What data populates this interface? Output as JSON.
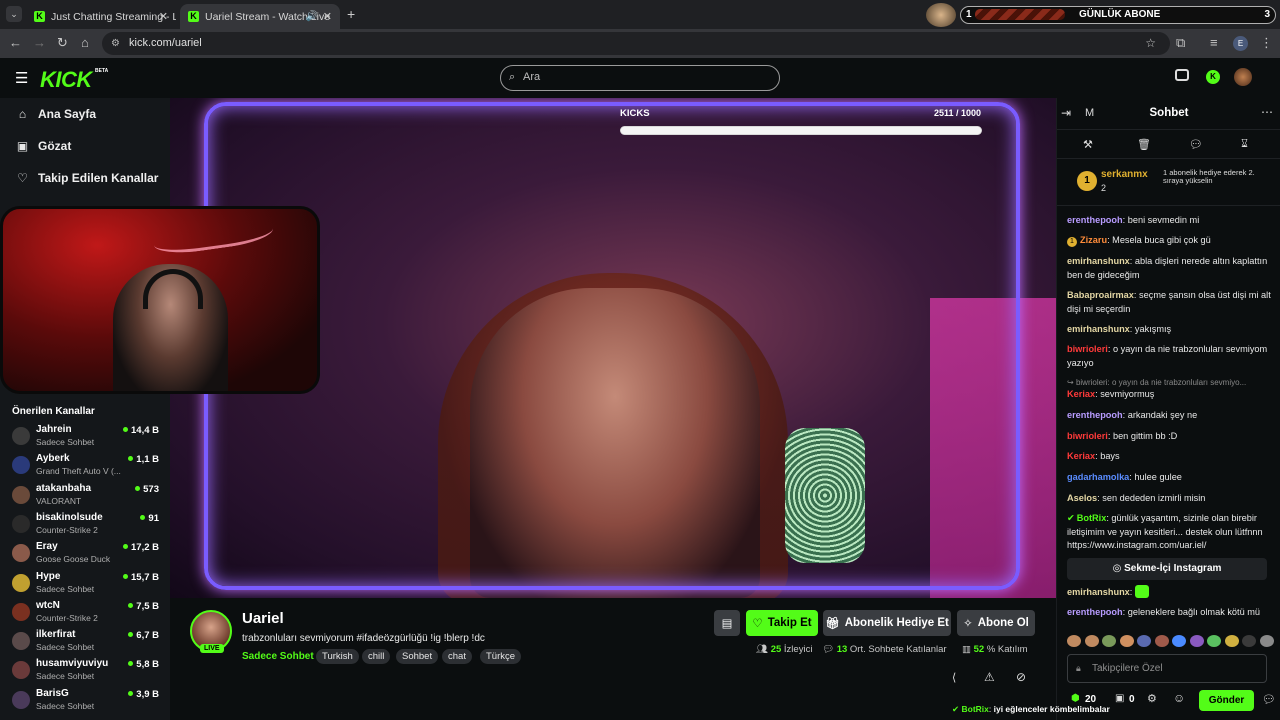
{
  "browser": {
    "tabs": [
      {
        "title": "Just Chatting Streaming - Live S"
      },
      {
        "title": "Uariel Stream - Watch Live"
      }
    ],
    "url": "kick.com/uariel",
    "ext_banner": {
      "left_num": "1",
      "label": "GÜNLÜK ABONE",
      "right_num": "3"
    },
    "profile_initial": "E"
  },
  "header": {
    "logo": "KICK",
    "beta": "BETA",
    "search_placeholder": "Ara"
  },
  "sidebar": {
    "nav": [
      {
        "label": "Ana Sayfa",
        "icon": "home-icon"
      },
      {
        "label": "Gözat",
        "icon": "browse-icon"
      },
      {
        "label": "Takip Edilen Kanallar",
        "icon": "heart-icon"
      }
    ],
    "recommended_title": "Önerilen Kanallar",
    "recommended": [
      {
        "name": "Jahrein",
        "category": "Sadece Sohbet",
        "viewers": "14,4 B",
        "color": "#3a3a3a"
      },
      {
        "name": "Ayberk",
        "category": "Grand Theft Auto V (...",
        "viewers": "1,1 B",
        "color": "#2a3a7a"
      },
      {
        "name": "atakanbaha",
        "category": "VALORANT",
        "viewers": "573",
        "color": "#6a4a3a"
      },
      {
        "name": "bisakinolsude",
        "category": "Counter-Strike 2",
        "viewers": "91",
        "color": "#2a2a2a"
      },
      {
        "name": "Eray",
        "category": "Goose Goose Duck",
        "viewers": "17,2 B",
        "color": "#8a5a4a"
      },
      {
        "name": "Hype",
        "category": "Sadece Sohbet",
        "viewers": "15,7 B",
        "color": "#c0a030"
      },
      {
        "name": "wtcN",
        "category": "Counter-Strike 2",
        "viewers": "7,5 B",
        "color": "#7a3020"
      },
      {
        "name": "ilkerfirat",
        "category": "Sadece Sohbet",
        "viewers": "6,7 B",
        "color": "#5a4a4a"
      },
      {
        "name": "husamviyuviyu",
        "category": "Sadece Sohbet",
        "viewers": "5,8 B",
        "color": "#6a3a3a"
      },
      {
        "name": "BarisG",
        "category": "Sadece Sohbet",
        "viewers": "3,9 B",
        "color": "#4a3a5a"
      }
    ]
  },
  "video": {
    "kicks_label": "KICKS",
    "kicks_value": "2511 / 1000",
    "kicks_progress": 1.0
  },
  "channel": {
    "name": "Uariel",
    "live": "LIVE",
    "title": "trabzonluları sevmiyorum #ifadeözgürlüğü !ig !blerp !dc",
    "category": "Sadece Sohbet",
    "tags": [
      "Turkish",
      "chill",
      "Sohbet",
      "chat",
      "Türkçe"
    ],
    "follow": "Takip Et",
    "gift_sub": "Abonelik Hediye Et",
    "subscribe": "Abone Ol",
    "stats": [
      {
        "value": "25",
        "label": "İzleyici"
      },
      {
        "value": "13",
        "label": "Ort. Sohbete Katılanlar"
      },
      {
        "value": "52",
        "label": "% Katılım"
      }
    ]
  },
  "chat": {
    "title": "Sohbet",
    "mode_letter": "M",
    "pinned": {
      "rank": "1",
      "user": "serkanmx",
      "count": "2",
      "note": "1 abonelik hediye ederek 2. sıraya yükselin"
    },
    "messages": [
      {
        "user": "erenthepooh",
        "color": "#b89cff",
        "text": "beni sevmedin mi"
      },
      {
        "user": "Zizaru",
        "color": "#ff8c3a",
        "text": "Mesela buca gibi çok gü"
      },
      {
        "user": "emirhanshunx",
        "color": "#e3d6a4",
        "text": "abla dişleri nerede altın kaplattın ben de gideceğim"
      },
      {
        "user": "Babaproairmax",
        "color": "#e3d6a4",
        "text": "seçme şansın olsa üst dişi mi alt dişi mi seçerdin"
      },
      {
        "user": "emirhanshunx",
        "color": "#e3d6a4",
        "text": "yakışmış"
      },
      {
        "user": "biwrioleri",
        "color": "#ff3a3a",
        "text": "o yayın da nie trabzonluları sevmiyom yazıyo"
      },
      {
        "user": "",
        "color": "#888888",
        "text": "biwrioleri: o yayın da nie trabzonluları sevmiyo..."
      },
      {
        "user": "Keriax",
        "color": "#ff3a3a",
        "text": "sevmiyormuş"
      },
      {
        "user": "erenthepooh",
        "color": "#b89cff",
        "text": "arkandaki şey ne"
      },
      {
        "user": "biwrioleri",
        "color": "#ff3a3a",
        "text": "ben gittim bb :D"
      },
      {
        "user": "Keriax",
        "color": "#ff3a3a",
        "text": "bays"
      },
      {
        "user": "gadarhamolka",
        "color": "#5a8cff",
        "text": "hulee gulee"
      },
      {
        "user": "Aselos",
        "color": "#e3d6a4",
        "text": "sen dededen izmirli misin"
      },
      {
        "user": "BotRix",
        "color": "#53fc18",
        "text": "günlük yaşantım, sizinle olan birebir iletişimim ve yayın kesitleri... destek olun lütfnnn https://www.instagram.com/uar.iel/"
      },
      {
        "user": "emirhanshunx",
        "color": "#e3d6a4",
        "text": ""
      },
      {
        "user": "erenthepooh",
        "color": "#b89cff",
        "text": "geleneklere bağlı olmak kötü mü"
      }
    ],
    "insta_button": "Sekme-İçi Instagram",
    "input_placeholder": "Takipçilere Özel",
    "points": "20",
    "gift_count": "0",
    "send": "Gönder",
    "footer_user": "BotRix",
    "footer_text": "iyi eğlenceler kömbelimbalar"
  }
}
